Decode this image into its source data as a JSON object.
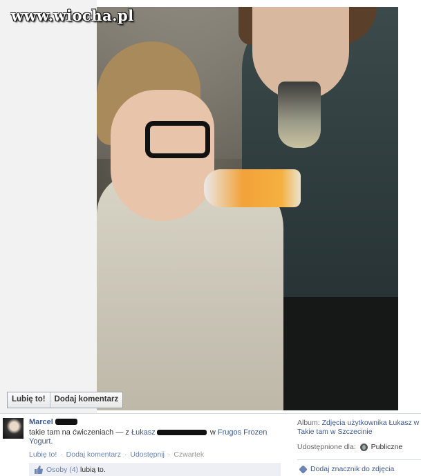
{
  "watermark": "www.wiocha.pl",
  "photo_actions": {
    "like_label": "Lubię to!",
    "comment_label": "Dodaj komentarz"
  },
  "post": {
    "author": "Marcel",
    "text_prefix": "takie tam na ćwiczeniach — z ",
    "tagged_user": "Łukasz",
    "text_middle": " w ",
    "place": "Frugos Frozen Yogurt",
    "text_suffix": ".",
    "actions": {
      "like": "Lubię to!",
      "comment": "Dodaj komentarz",
      "share": "Udostępnij",
      "time": "Czwartek"
    },
    "likes": {
      "people_link": "Osoby (4)",
      "text": "lubią to."
    }
  },
  "sidebar": {
    "album_label": "Album:",
    "album_link_line1": "Zdjęcia użytkownika Łukasz w",
    "album_link_line2": "Takie tam w Szczecinie",
    "shared_label": "Udostępnione dla:",
    "shared_value": "Publiczne",
    "tag_link": "Dodaj znacznik do zdjęcia"
  },
  "colors": {
    "link": "#3b5998",
    "meta_link": "#6d84b4",
    "likes_bg": "#edeff4"
  }
}
